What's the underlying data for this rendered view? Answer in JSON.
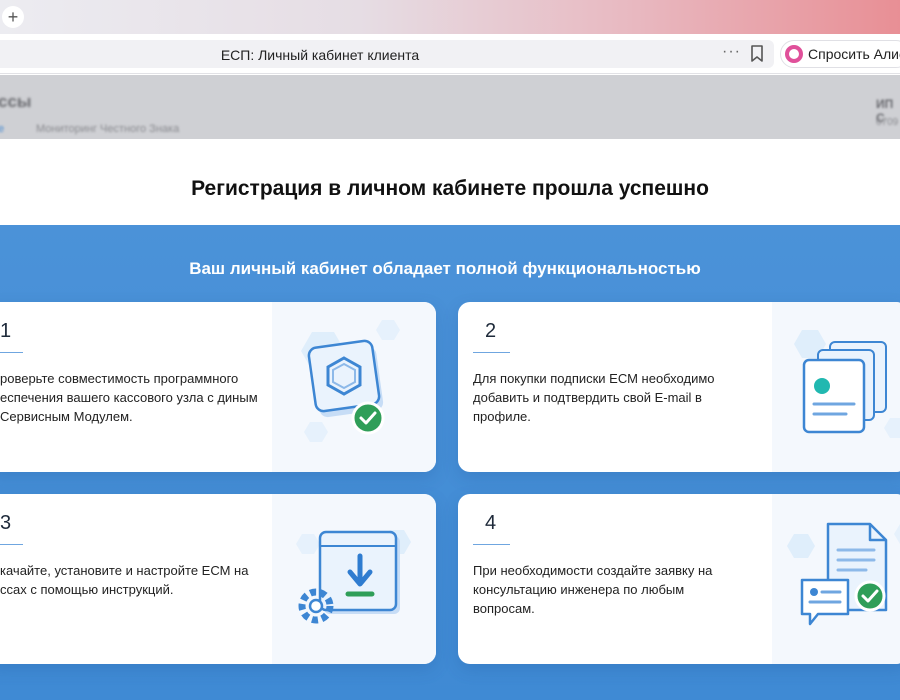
{
  "browser": {
    "new_tab_symbol": "+",
    "page_title": "ЕСП: Личный кабинет клиента",
    "more_symbol": "···",
    "alice_label": "Спросить Алису"
  },
  "background_page": {
    "title": "ссы",
    "link_active": "е",
    "link_other": "Мониторинг Честного Знака",
    "user_name": "ИП С",
    "user_sub": "6709"
  },
  "modal": {
    "title": "Регистрация в личном кабинете прошла успешно",
    "subtitle": "Ваш личный кабинет обладает полной функциональностью",
    "accent_color": "#4390d6",
    "cards": [
      {
        "number": "1",
        "text": "роверьте совместимость программного еспечения вашего кассового узла с диным Сервисным Модулем.",
        "icon": "hexagon-check-icon"
      },
      {
        "number": "2",
        "text": "Для покупки подписки ЕСМ необходимо добавить и подтвердить свой E-mail в профиле.",
        "icon": "profile-cards-icon"
      },
      {
        "number": "3",
        "text": "качайте, установите и настройте ЕСМ на ссах с помощью инструкций.",
        "icon": "download-gear-icon"
      },
      {
        "number": "4",
        "text": "При необходимости создайте заявку на консультацию инженера по любым вопросам.",
        "icon": "document-chat-icon"
      }
    ]
  }
}
